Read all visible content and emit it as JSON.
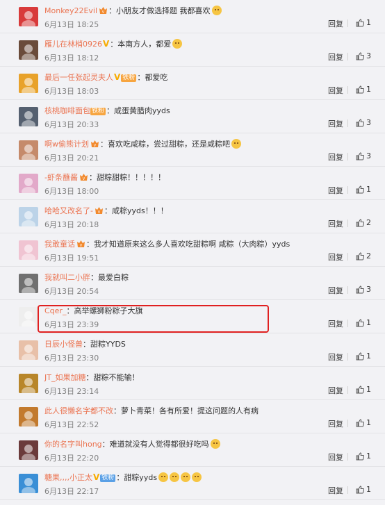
{
  "ui": {
    "reply_label": "回复"
  },
  "comments": [
    {
      "user": "Monkey22Evil",
      "badge": true,
      "v": false,
      "fan": "",
      "fan_color": "",
      "text": "小朋友才做选择题 我都喜欢",
      "emoji": 1,
      "date": "6月13日 18:25",
      "likes": "1",
      "avatar_color": "#d83a3a"
    },
    {
      "user": "雁儿在林梢0926",
      "badge": false,
      "v": true,
      "fan": "",
      "fan_color": "",
      "text": "本南方人，都爱",
      "emoji": 1,
      "date": "6月13日 18:12",
      "likes": "3",
      "avatar_color": "#6a4b3a"
    },
    {
      "user": "最后一任张起灵夫人",
      "badge": false,
      "v": true,
      "fan": "铁粉",
      "fan_color": "orange",
      "text": "都爱吃",
      "emoji": 0,
      "date": "6月13日 18:03",
      "likes": "1",
      "avatar_color": "#e8a22a"
    },
    {
      "user": "核桃咖啡面包",
      "badge": false,
      "v": false,
      "fan": "铁粉",
      "fan_color": "orange",
      "text": "咸蛋黄腊肉yyds",
      "emoji": 0,
      "date": "6月13日 20:33",
      "likes": "3",
      "avatar_color": "#556070"
    },
    {
      "user": "啊w偷熊计划",
      "badge": true,
      "v": false,
      "fan": "",
      "fan_color": "",
      "text": "喜欢吃咸粽，尝过甜粽，还是咸粽吧",
      "emoji": 1,
      "date": "6月13日 20:21",
      "likes": "3",
      "avatar_color": "#c58a6a"
    },
    {
      "user": "-虾条蘸酱",
      "badge": true,
      "v": false,
      "fan": "",
      "fan_color": "",
      "text": "甜粽甜粽！！！！！",
      "emoji": 0,
      "date": "6月13日 18:00",
      "likes": "1",
      "avatar_color": "#e2a9c9"
    },
    {
      "user": "哈哈又改名了-",
      "badge": true,
      "v": false,
      "fan": "",
      "fan_color": "",
      "text": "咸粽yyds！！！",
      "emoji": 0,
      "date": "6月13日 20:18",
      "likes": "2",
      "avatar_color": "#bcd3e8"
    },
    {
      "user": "我敢童话",
      "badge": true,
      "v": false,
      "fan": "",
      "fan_color": "",
      "text": "我才知道原来这么多人喜欢吃甜粽啊 咸粽（大肉粽）yyds",
      "emoji": 0,
      "date": "6月13日 19:51",
      "likes": "2",
      "avatar_color": "#f0c4d2"
    },
    {
      "user": "我就叫二小胖",
      "badge": false,
      "v": false,
      "fan": "",
      "fan_color": "",
      "text": "最爱白粽",
      "emoji": 0,
      "date": "6月13日 20:54",
      "likes": "3",
      "avatar_color": "#707070"
    },
    {
      "user": "Cqer_",
      "badge": false,
      "v": false,
      "fan": "",
      "fan_color": "",
      "text": "高举螺狮粉粽子大旗",
      "emoji": 0,
      "date": "6月13日 23:39",
      "likes": "1",
      "avatar_color": "#eeeeee"
    },
    {
      "user": "日辰小怪兽",
      "badge": false,
      "v": false,
      "fan": "",
      "fan_color": "",
      "text": "甜粽YYDS",
      "emoji": 0,
      "date": "6月13日 23:30",
      "likes": "1",
      "avatar_color": "#e8c0a8"
    },
    {
      "user": "JT_如果加糖",
      "badge": false,
      "v": false,
      "fan": "",
      "fan_color": "",
      "text": "甜粽不能输！",
      "emoji": 0,
      "date": "6月13日 23:14",
      "likes": "1",
      "avatar_color": "#b8862a"
    },
    {
      "user": "此人很懒名字都不改",
      "badge": false,
      "v": false,
      "fan": "",
      "fan_color": "",
      "text": "萝卜青菜！各有所爱！提这问题的人有病",
      "emoji": 0,
      "date": "6月13日 22:52",
      "likes": "1",
      "avatar_color": "#c27a2e"
    },
    {
      "user": "你的名字叫hong",
      "badge": false,
      "v": false,
      "fan": "",
      "fan_color": "",
      "text": "难道就没有人觉得都很好吃吗",
      "emoji": 1,
      "date": "6月13日 22:20",
      "likes": "1",
      "avatar_color": "#6b3b3b"
    },
    {
      "user": "糖果,,,,小正太",
      "badge": false,
      "v": true,
      "fan": "铁粉",
      "fan_color": "blue",
      "text": "甜粽yyds",
      "emoji": 4,
      "date": "6月13日 22:17",
      "likes": "1",
      "avatar_color": "#3a8fd6"
    }
  ]
}
